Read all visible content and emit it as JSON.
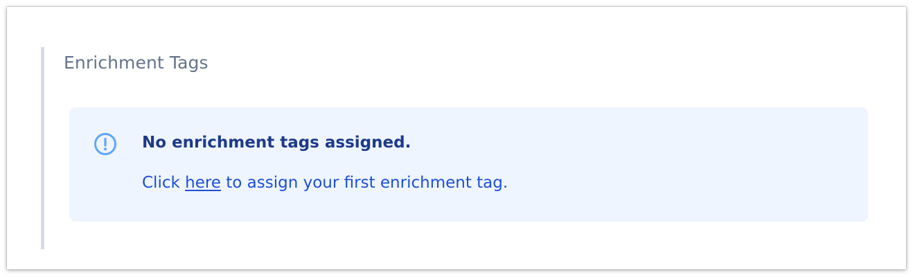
{
  "section": {
    "title": "Enrichment Tags"
  },
  "alert": {
    "icon": "info-exclamation-icon",
    "heading": "No enrichment tags assigned.",
    "body_prefix": "Click ",
    "link_label": "here",
    "body_suffix": " to assign your first enrichment tag."
  },
  "colors": {
    "section_border": "#d4dde7",
    "title_text": "#64748b",
    "alert_background": "#eef5fe",
    "alert_heading": "#1e3a8a",
    "alert_body": "#1d4ed8",
    "icon_stroke": "#60a5fa"
  }
}
